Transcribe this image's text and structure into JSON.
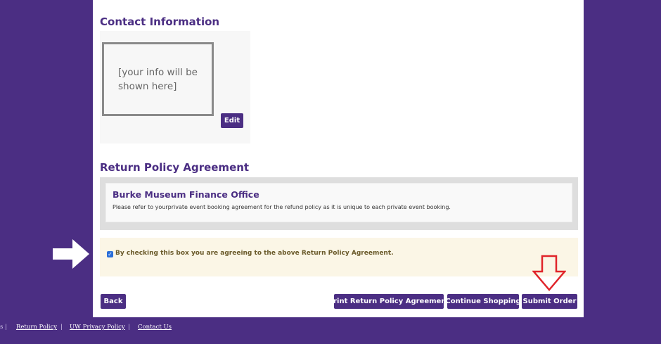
{
  "contact": {
    "title": "Contact Information",
    "placeholder": "[your info will be shown here]",
    "edit_label": "Edit"
  },
  "return_policy": {
    "title": "Return Policy Agreement",
    "office_title": "Burke Museum Finance Office",
    "text": "Please refer to yourprivate event booking agreement for the refund policy as it is unique to each private event booking."
  },
  "agreement": {
    "checked": true,
    "label": "By checking this box you are agreeing to the above Return Policy Agreement."
  },
  "actions": {
    "back_label": "Back",
    "print_label": "Print Return Policy Agreement",
    "continue_label": "Continue Shopping",
    "submit_label": "Submit Order"
  },
  "footer": {
    "leading_sep": "s |",
    "links": [
      "Return Policy",
      "UW Privacy Policy",
      "Contact Us"
    ]
  },
  "colors": {
    "background": "#4b2e83",
    "button": "#4b2e83",
    "annotation_arrow": "#e0242a"
  }
}
